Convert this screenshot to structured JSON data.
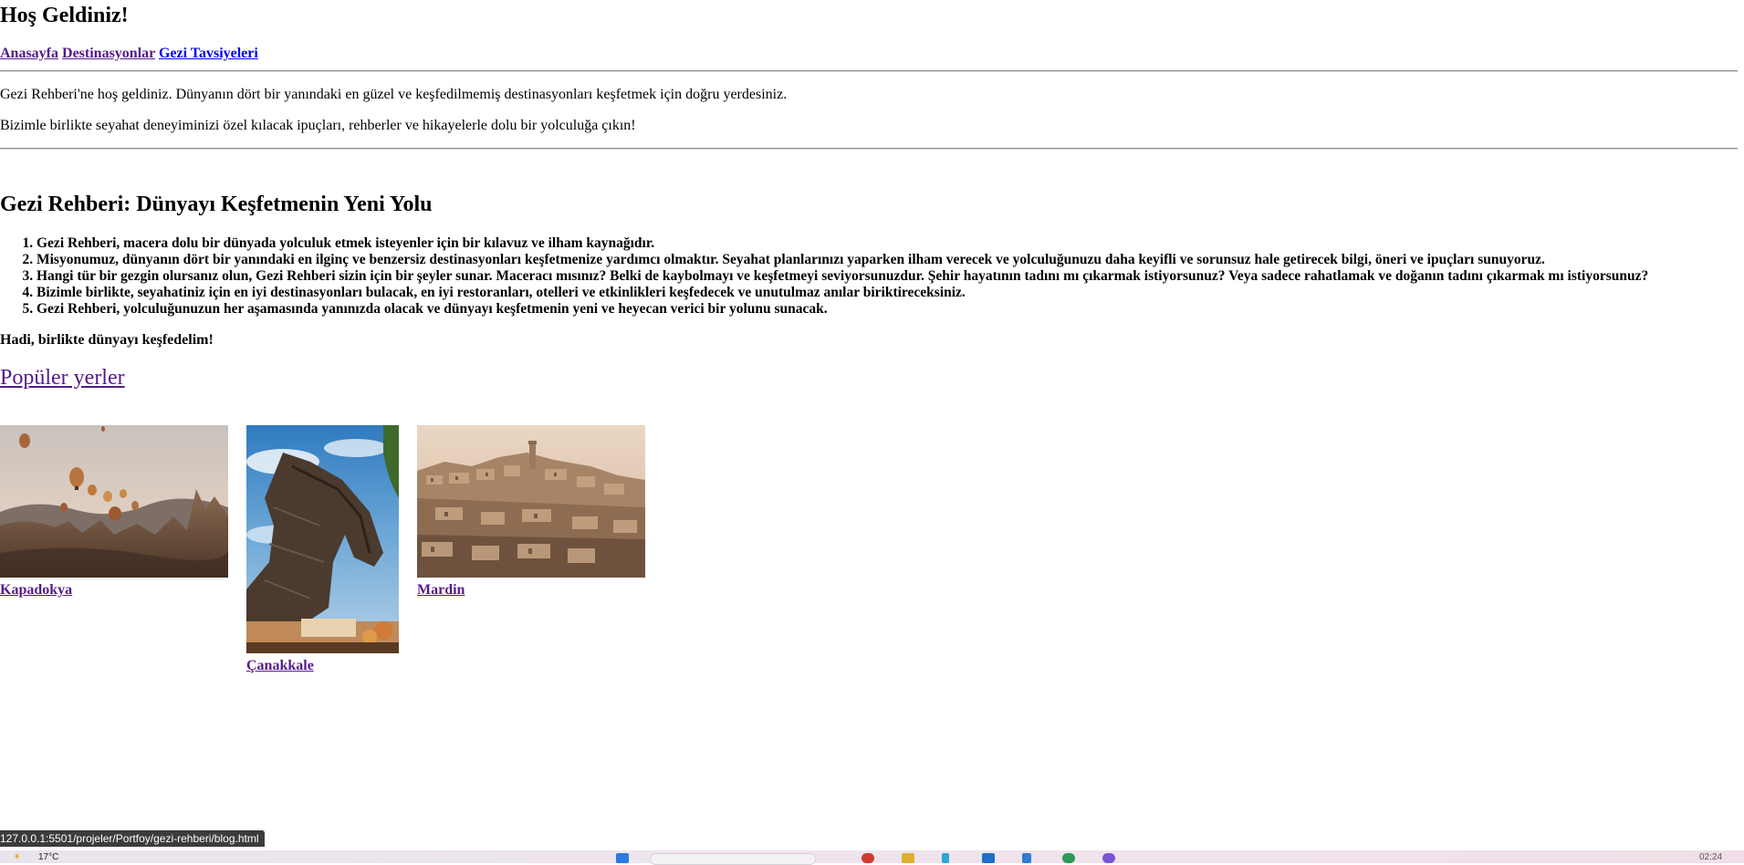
{
  "header": {
    "title": "Hoş Geldiniz!"
  },
  "nav": {
    "items": [
      "Anasayfa",
      "Destinasyonlar",
      "Gezi Tavsiyeleri"
    ]
  },
  "intro": {
    "p1": "Gezi Rehberi'ne hoş geldiniz. Dünyanın dört bir yanındaki en güzel ve keşfedilmemiş destinasyonları keşfetmek için doğru yerdesiniz.",
    "p2": "Bizimle birlikte seyahat deneyiminizi özel kılacak ipuçları, rehberler ve hikayelerle dolu bir yolculuğa çıkın!"
  },
  "guide": {
    "title": "Gezi Rehberi: Dünyayı Keşfetmenin Yeni Yolu",
    "points": [
      "Gezi Rehberi, macera dolu bir dünyada yolculuk etmek isteyenler için bir kılavuz ve ilham kaynağıdır.",
      "Misyonumuz, dünyanın dört bir yanındaki en ilginç ve benzersiz destinasyonları keşfetmenize yardımcı olmaktır. Seyahat planlarınızı yaparken ilham verecek ve yolculuğunuzu daha keyifli ve sorunsuz hale getirecek bilgi, öneri ve ipuçları sunuyoruz.",
      "Hangi tür bir gezgin olursanız olun, Gezi Rehberi sizin için bir şeyler sunar. Maceracı mısınız? Belki de kaybolmayı ve keşfetmeyi seviyorsunuzdur. Şehir hayatının tadını mı çıkarmak istiyorsunuz? Veya sadece rahatlamak ve doğanın tadını çıkarmak mı istiyorsunuz?",
      "Bizimle birlikte, seyahatiniz için en iyi destinasyonları bulacak, en iyi restoranları, otelleri ve etkinlikleri keşfedecek ve unutulmaz anılar biriktireceksiniz.",
      "Gezi Rehberi, yolculuğunuzun her aşamasında yanınızda olacak ve dünyayı keşfetmenin yeni ve heyecan verici bir yolunu sunacak."
    ],
    "closing": "Hadi, birlikte dünyayı keşfedelim!"
  },
  "popular": {
    "title": "Popüler yerler",
    "places": [
      {
        "name": "Kapadokya",
        "image": "hot-air-balloons-landscape"
      },
      {
        "name": "Çanakkale",
        "image": "trojan-horse-statue"
      },
      {
        "name": "Mardin",
        "image": "hillside-stone-city"
      }
    ]
  },
  "browser": {
    "status_url": "127.0.0.1:5501/projeler/Portfoy/gezi-rehberi/blog.html"
  },
  "taskbar": {
    "weather": "17°C",
    "clock": "02:24"
  }
}
